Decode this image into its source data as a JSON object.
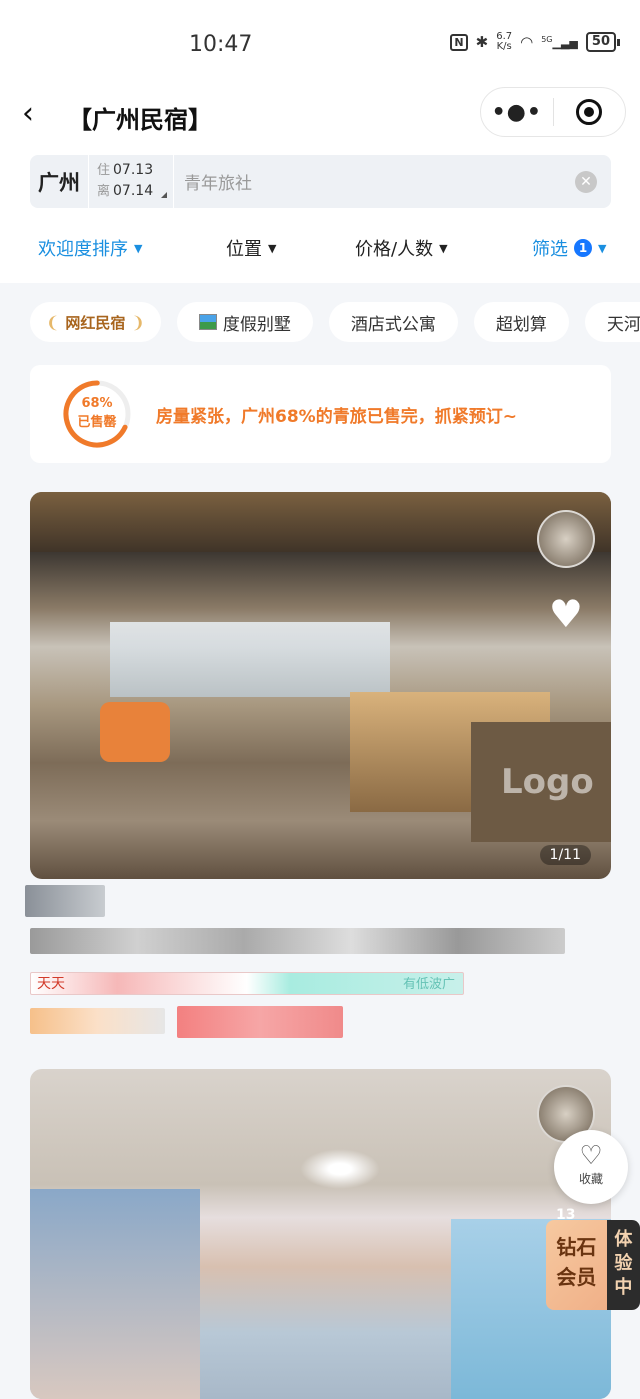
{
  "status_bar": {
    "time": "10:47",
    "net_speed_top": "6.7",
    "net_speed_bottom": "K/s",
    "network": "5G",
    "battery": "50",
    "icons": [
      "nfc-icon",
      "bluetooth-icon",
      "wifi-icon",
      "signal-icon",
      "battery-icon"
    ]
  },
  "nav": {
    "back_icon": "‹",
    "title": "【广州民宿】",
    "more_label": "•●•",
    "target_icon": "record-icon"
  },
  "search": {
    "city": "广州",
    "checkin_label": "住",
    "checkin_date": "07.13",
    "checkout_label": "离",
    "checkout_date": "07.14",
    "keyword": "青年旅社",
    "clear_icon": "✕"
  },
  "filters": {
    "sort": "欢迎度排序",
    "location": "位置",
    "price": "价格/人数",
    "filter": "筛选",
    "filter_count": "1"
  },
  "chips": [
    {
      "label": "网红民宿",
      "type": "special"
    },
    {
      "label": "度假别墅",
      "icon": "villa-icon"
    },
    {
      "label": "酒店式公寓"
    },
    {
      "label": "超划算"
    },
    {
      "label": "天河区"
    }
  ],
  "alert": {
    "percent_text": "68%",
    "percent_value": 68,
    "ring_sub": "已售罄",
    "message": "房量紧张，广州68%的青旅已售完，抓紧预订~",
    "accent": "#f07a2a"
  },
  "listings": [
    {
      "image_counter": "1/11",
      "logo_text": "Logo",
      "tag_prefix": "天天",
      "tag_suffix": "有低波广"
    },
    {}
  ],
  "floating": {
    "fav_label": "收藏",
    "fav_count": "13",
    "vip_line1": "钻石",
    "vip_line2": "会员",
    "trial": "体验中"
  }
}
